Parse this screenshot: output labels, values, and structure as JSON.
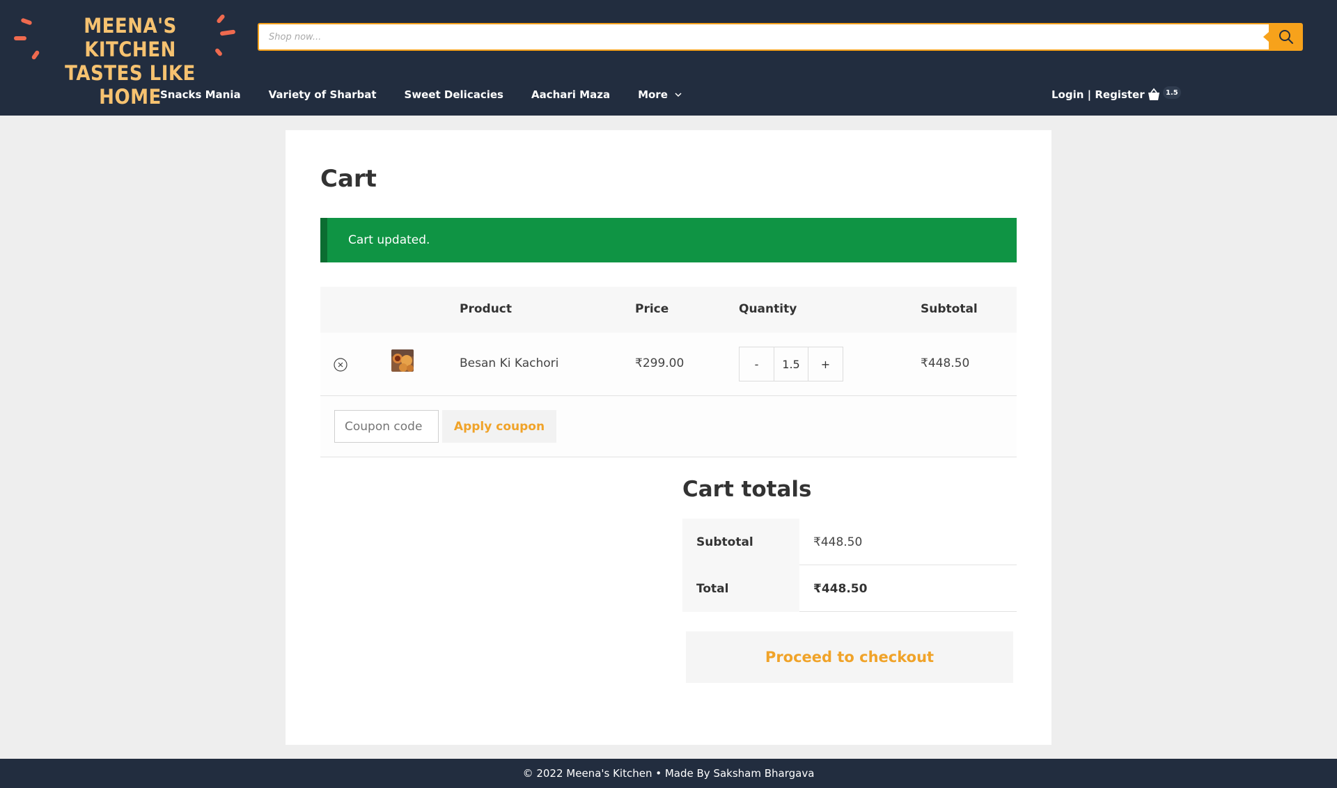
{
  "brand": {
    "logo_line1": "MEENA'S KITCHEN",
    "logo_line2": "TASTES LIKE HOME",
    "colors": {
      "header_bg": "#222d3f",
      "accent": "#f7a21b",
      "logo_text": "#f6c270",
      "logo_dash": "#ef6a4f",
      "notice_bg": "#0f9444"
    }
  },
  "search": {
    "placeholder": "Shop now...",
    "icon": "search-icon"
  },
  "nav": {
    "items": [
      "Snacks Mania",
      "Variety of Sharbat",
      "Sweet Delicacies",
      "Aachari Maza"
    ],
    "more_label": "More",
    "account_label": "Login | Register",
    "cart_count": "1.5"
  },
  "page": {
    "title": "Cart",
    "notice": "Cart updated."
  },
  "cart_table": {
    "headers": {
      "product": "Product",
      "price": "Price",
      "quantity": "Quantity",
      "subtotal": "Subtotal"
    },
    "rows": [
      {
        "product": "Besan Ki Kachori",
        "price": "₹299.00",
        "quantity": "1.5",
        "subtotal": "₹448.50",
        "qty_minus": "-",
        "qty_plus": "+"
      }
    ],
    "coupon_placeholder": "Coupon code",
    "apply_coupon_label": "Apply coupon"
  },
  "totals": {
    "title": "Cart totals",
    "subtotal_label": "Subtotal",
    "subtotal_value": "₹448.50",
    "total_label": "Total",
    "total_value": "₹448.50",
    "checkout_label": "Proceed to checkout"
  },
  "footer": {
    "text": "© 2022 Meena's Kitchen • Made By Saksham Bhargava"
  }
}
